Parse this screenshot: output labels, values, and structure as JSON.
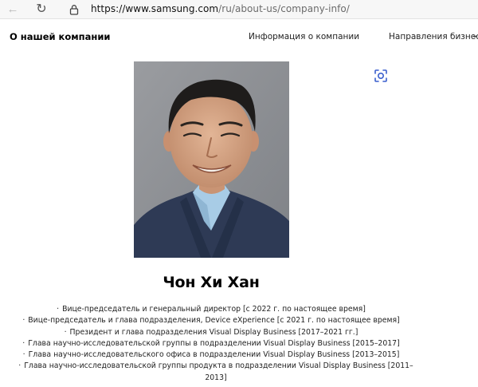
{
  "browser": {
    "url_host": "https://www.samsung.com",
    "url_path": "/ru/about-us/company-info/"
  },
  "nav": {
    "brand": "О нашей компании",
    "links": [
      "Информация о компании",
      "Направления бизнеса"
    ]
  },
  "profile": {
    "name": "Чон Хи Хан",
    "career": [
      "Вице-председатель и генеральный директор [с 2022 г. по настоящее время]",
      "Вице-председатель и глава подразделения, Device eXperience [с 2021 г. по настоящее время]",
      "Президент и глава подразделения Visual Display Business [2017–2021 гг.]",
      "Глава научно-исследовательской группы в подразделении Visual Display Business [2015–2017]",
      "Глава научно-исследовательского офиса в подразделении Visual Display Business [2013–2015]",
      "Глава научно-исследовательской группы продукта в подразделении Visual Display Business [2011–2013]"
    ]
  },
  "icons": {
    "back": "arrow-left-icon",
    "reload": "reload-icon",
    "lock": "lock-icon",
    "scan": "image-search-icon",
    "chevron": "chevron-down-icon"
  },
  "colors": {
    "background": "#ffffff",
    "text": "#000000",
    "photo_backdrop": "#8e9195",
    "suit": "#2e3a55",
    "shirt": "#a8cce6"
  }
}
